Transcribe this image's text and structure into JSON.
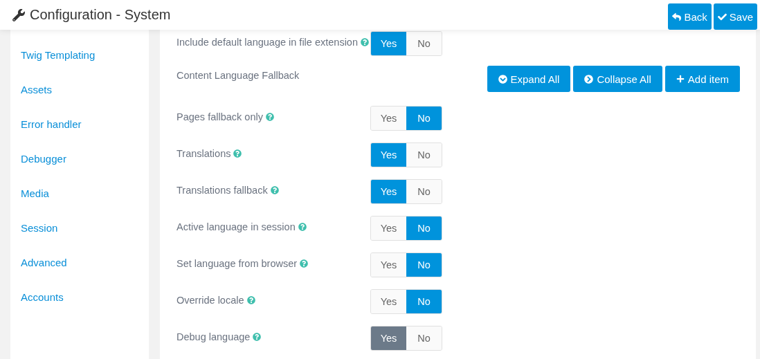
{
  "header": {
    "title": "Configuration - System",
    "buttons": [
      {
        "label": "Back",
        "kind": "back"
      },
      {
        "label": "Save",
        "kind": "save"
      }
    ]
  },
  "sidebar": {
    "items": [
      {
        "label": "Twig Templating"
      },
      {
        "label": "Assets"
      },
      {
        "label": "Error handler"
      },
      {
        "label": "Debugger"
      },
      {
        "label": "Media"
      },
      {
        "label": "Session"
      },
      {
        "label": "Advanced"
      },
      {
        "label": "Accounts"
      }
    ]
  },
  "settings": [
    {
      "kind": "toggle",
      "label": "Include default language in file extension",
      "help": true,
      "color": "#0093dc",
      "options": [
        {
          "label": "Yes",
          "selected": true
        },
        {
          "label": "No",
          "selected": false
        }
      ]
    },
    {
      "kind": "list",
      "label": "Content Language Fallback",
      "buttons": [
        {
          "label": "Expand All",
          "kind": "expand"
        },
        {
          "label": "Collapse All",
          "kind": "collapse"
        },
        {
          "label": "Add item",
          "kind": "add"
        }
      ]
    },
    {
      "kind": "toggle",
      "label": "Pages fallback only",
      "help": true,
      "color": "#0093dc",
      "options": [
        {
          "label": "Yes",
          "selected": false
        },
        {
          "label": "No",
          "selected": true
        }
      ]
    },
    {
      "kind": "toggle",
      "label": "Translations",
      "help": true,
      "color": "#0093dc",
      "options": [
        {
          "label": "Yes",
          "selected": true
        },
        {
          "label": "No",
          "selected": false
        }
      ]
    },
    {
      "kind": "toggle",
      "label": "Translations fallback",
      "help": true,
      "color": "#0093dc",
      "options": [
        {
          "label": "Yes",
          "selected": true
        },
        {
          "label": "No",
          "selected": false
        }
      ]
    },
    {
      "kind": "toggle",
      "label": "Active language in session",
      "help": true,
      "color": "#0093dc",
      "options": [
        {
          "label": "Yes",
          "selected": false
        },
        {
          "label": "No",
          "selected": true
        }
      ]
    },
    {
      "kind": "toggle",
      "label": "Set language from browser",
      "help": true,
      "color": "#0093dc",
      "options": [
        {
          "label": "Yes",
          "selected": false
        },
        {
          "label": "No",
          "selected": true
        }
      ]
    },
    {
      "kind": "toggle",
      "label": "Override locale",
      "help": true,
      "color": "#0093dc",
      "options": [
        {
          "label": "Yes",
          "selected": false
        },
        {
          "label": "No",
          "selected": true
        }
      ]
    },
    {
      "kind": "toggle",
      "label": "Debug language",
      "help": true,
      "color": "#6c7a89",
      "options": [
        {
          "label": "Yes",
          "selected": true
        },
        {
          "label": "No",
          "selected": false
        }
      ]
    }
  ]
}
